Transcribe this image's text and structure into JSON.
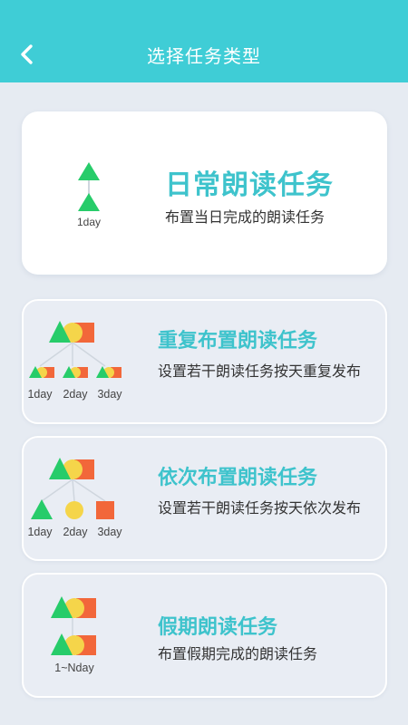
{
  "header": {
    "title": "选择任务类型"
  },
  "icons": {
    "back": "chevron-left-icon"
  },
  "colors": {
    "header_bg": "#3fcdd6",
    "accent_text": "#3ec3cc",
    "green": "#27cc6a",
    "yellow": "#f5d54a",
    "orange": "#f2673a"
  },
  "cards": [
    {
      "title": "日常朗读任务",
      "description": "布置当日完成的朗读任务",
      "labels": [
        "1day"
      ]
    },
    {
      "title": "重复布置朗读任务",
      "description": "设置若干朗读任务按天重复发布",
      "labels": [
        "1day",
        "2day",
        "3day"
      ]
    },
    {
      "title": "依次布置朗读任务",
      "description": "设置若干朗读任务按天依次发布",
      "labels": [
        "1day",
        "2day",
        "3day"
      ]
    },
    {
      "title": "假期朗读任务",
      "description": "布置假期完成的朗读任务",
      "labels": [
        "1~Nday"
      ]
    }
  ]
}
